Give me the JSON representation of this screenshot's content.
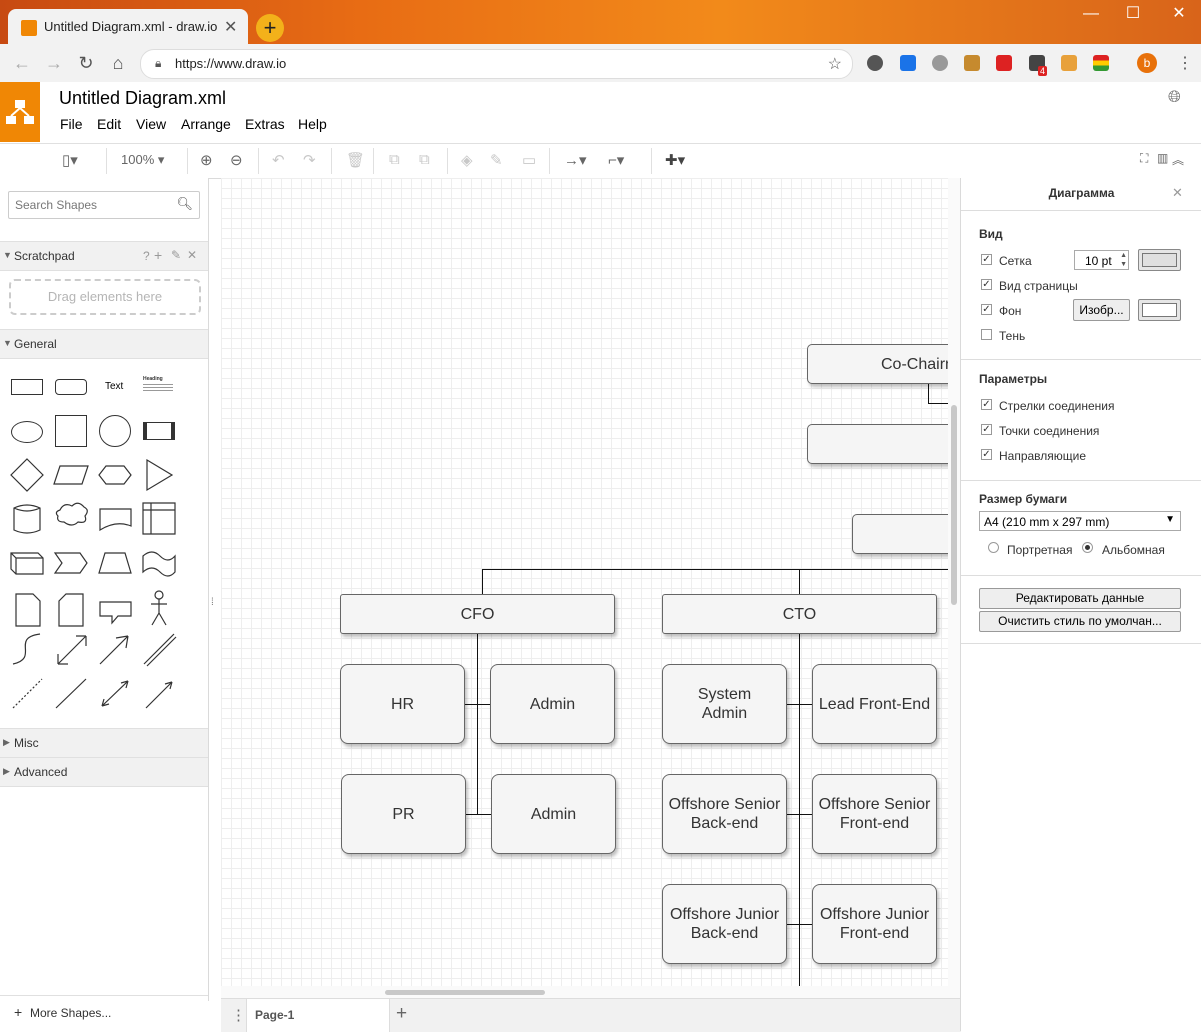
{
  "browser": {
    "tab_title": "Untitled Diagram.xml - draw.io",
    "url": "https://www.draw.io",
    "new_tab": "+",
    "ext_badge": "4",
    "profile_letter": "b"
  },
  "app": {
    "doc_title": "Untitled Diagram.xml",
    "menu": [
      "File",
      "Edit",
      "View",
      "Arrange",
      "Extras",
      "Help"
    ],
    "zoom": "100%"
  },
  "sidebar": {
    "search_placeholder": "Search Shapes",
    "scratchpad": "Scratchpad",
    "scratchpad_help": "?",
    "drag_hint": "Drag elements here",
    "general": "General",
    "shape_text": "Text",
    "shape_heading": "Heading",
    "misc": "Misc",
    "advanced": "Advanced",
    "more_shapes": "More Shapes..."
  },
  "diagram": {
    "nodes": [
      "Co-Chairm",
      "CFO",
      "CTO",
      "HR",
      "Admin",
      "Admin",
      "PR",
      "System Admin",
      "Lead Front-End",
      "Offshore Senior Back-end",
      "Offshore Senior Front-end",
      "Offshore Junior Back-end",
      "Offshore Junior Front-end"
    ]
  },
  "pages": {
    "current": "Page-1"
  },
  "format_panel": {
    "title": "Диаграмма",
    "view_section": "Вид",
    "grid": "Сетка",
    "grid_size": "10 pt",
    "page_view": "Вид страницы",
    "background": "Фон",
    "image_button": "Изобр...",
    "shadow": "Тень",
    "options_section": "Параметры",
    "connection_arrows": "Стрелки соединения",
    "connection_points": "Точки соединения",
    "guides": "Направляющие",
    "paper_size_section": "Размер бумаги",
    "paper_size": "A4 (210 mm x 297 mm)",
    "portrait": "Портретная",
    "landscape": "Альбомная",
    "edit_data": "Редактировать данные",
    "clear_default_style": "Очистить стиль по умолчан..."
  },
  "colors": {
    "accent": "#f08705",
    "grid": "#eeeeee",
    "node_fill": "#f5f5f5"
  }
}
